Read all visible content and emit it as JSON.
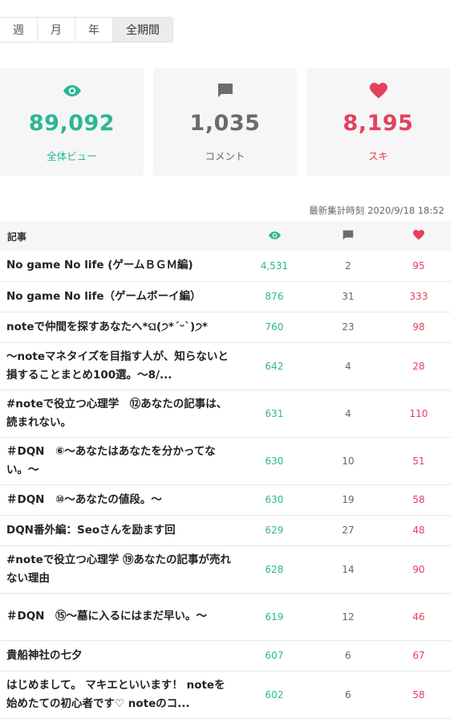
{
  "period_tabs": [
    {
      "label": "週"
    },
    {
      "label": "月"
    },
    {
      "label": "年"
    },
    {
      "label": "全期間"
    }
  ],
  "active_tab": 3,
  "stats": {
    "views": {
      "value": "89,092",
      "label": "全体ビュー",
      "color": "#2cb696",
      "icon": "eye-icon"
    },
    "comments": {
      "value": "1,035",
      "label": "コメント",
      "color": "#6b6b6b",
      "icon": "comment-icon"
    },
    "likes": {
      "value": "8,195",
      "label": "スキ",
      "color": "#e5405e",
      "icon": "heart-icon"
    }
  },
  "updated": {
    "label": "最新集計時刻",
    "time": "2020/9/18 18:52"
  },
  "table": {
    "header": {
      "title": "記事"
    },
    "rows": [
      {
        "title": "No game No life (ゲームＢＧＭ編)",
        "views": "4,531",
        "comments": "2",
        "likes": "95"
      },
      {
        "title": "No game No life（ゲームボーイ編）",
        "views": "876",
        "comments": "31",
        "likes": "333"
      },
      {
        "title": "noteで仲間を探すあなたへ*ଘ(੭*ˊᵕˋ)੭*",
        "views": "760",
        "comments": "23",
        "likes": "98"
      },
      {
        "title": "～noteマネタイズを目指す人が、知らないと損することまとめ100選。～8/...",
        "views": "642",
        "comments": "4",
        "likes": "28"
      },
      {
        "title": "#noteで役立つ心理学　⑫あなたの記事は、読まれない。",
        "views": "631",
        "comments": "4",
        "likes": "110"
      },
      {
        "title": "＃DQN　⑥～あなたはあなたを分かってない。～",
        "views": "630",
        "comments": "10",
        "likes": "51"
      },
      {
        "title": "＃DQN　⑩～あなたの値段。～",
        "views": "630",
        "comments": "19",
        "likes": "58"
      },
      {
        "title": "DQN番外編：Seoさんを励ます回",
        "views": "629",
        "comments": "27",
        "likes": "48"
      },
      {
        "title": "#noteで役立つ心理学 ⑲あなたの記事が売れない理由",
        "views": "628",
        "comments": "14",
        "likes": "90"
      },
      {
        "title": "＃DQN　⑮～墓に入るにはまだ早い。～",
        "views": "619",
        "comments": "12",
        "likes": "46"
      },
      {
        "title": "貴船神社の七夕",
        "views": "607",
        "comments": "6",
        "likes": "67"
      },
      {
        "title": "はじめまして。 マキエといいます！ noteを始めたての初心者です♡ noteのコ...",
        "views": "602",
        "comments": "6",
        "likes": "58"
      }
    ]
  }
}
